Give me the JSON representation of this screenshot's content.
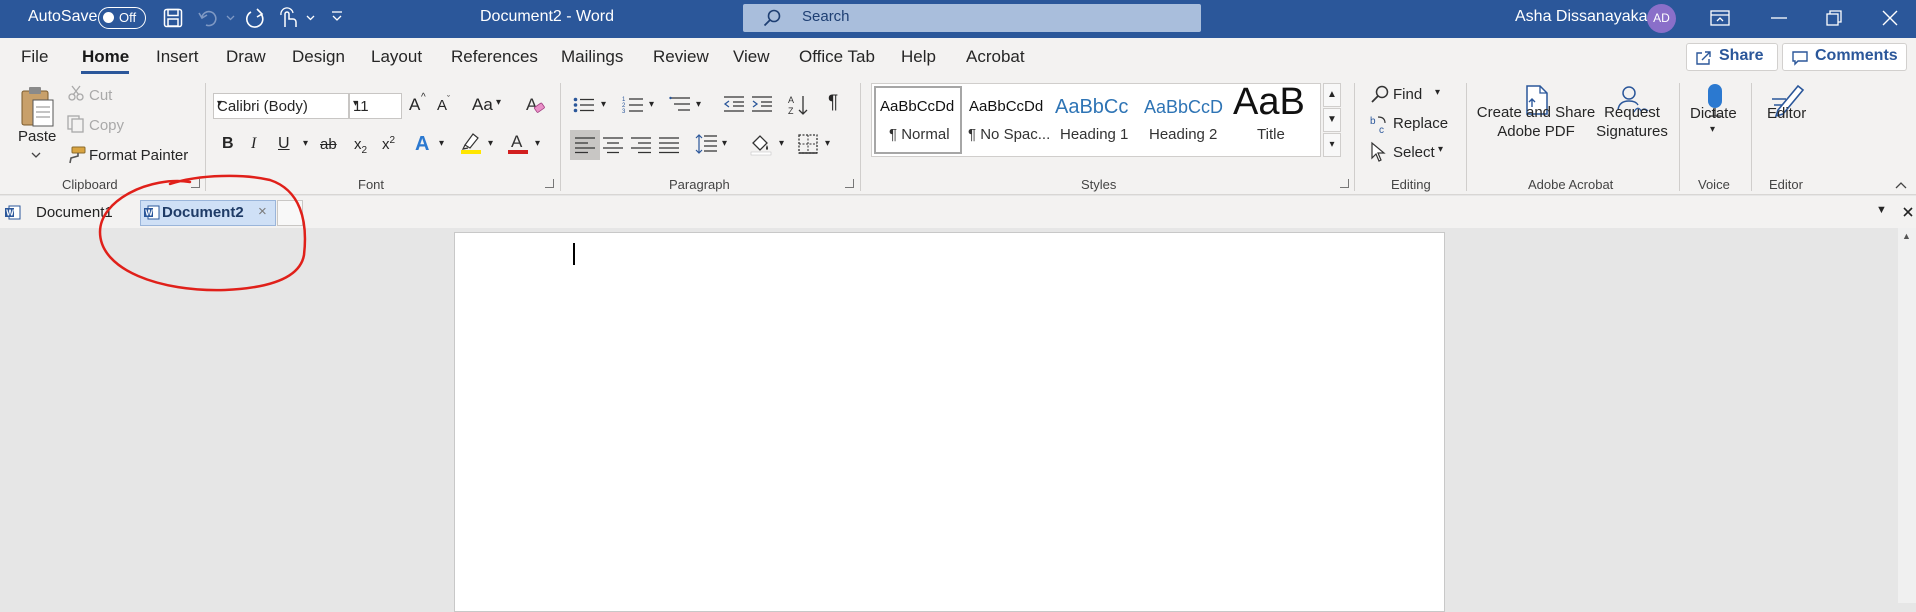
{
  "titlebar": {
    "autosave_label": "AutoSave",
    "autosave_state": "Off",
    "doc_title": "Document2  -  Word",
    "search_placeholder": "Search",
    "user_name": "Asha Dissanayaka",
    "user_initials": "AD"
  },
  "menu": {
    "items": [
      "File",
      "Home",
      "Insert",
      "Draw",
      "Design",
      "Layout",
      "References",
      "Mailings",
      "Review",
      "View",
      "Office Tab",
      "Help",
      "Acrobat"
    ],
    "active": "Home",
    "share_label": "Share",
    "comments_label": "Comments"
  },
  "clipboard": {
    "paste_label": "Paste",
    "cut_label": "Cut",
    "copy_label": "Copy",
    "format_painter_label": "Format Painter",
    "group_label": "Clipboard"
  },
  "font": {
    "font_name": "Calibri (Body)",
    "font_size": "11",
    "group_label": "Font",
    "bold": "B",
    "italic": "I",
    "underline": "U",
    "strike": "ab",
    "subscript": "x",
    "superscript": "x",
    "grow": "A",
    "shrink": "A",
    "change_case": "Aa",
    "effects": "A",
    "font_color": "A"
  },
  "paragraph": {
    "group_label": "Paragraph",
    "show_marks": "¶"
  },
  "styles": {
    "group_label": "Styles",
    "items": [
      {
        "preview": "AaBbCcDd",
        "name": "¶ Normal"
      },
      {
        "preview": "AaBbCcDd",
        "name": "¶ No Spac..."
      },
      {
        "preview": "AaBbCc",
        "name": "Heading 1"
      },
      {
        "preview": "AaBbCcD",
        "name": "Heading 2"
      },
      {
        "preview": "AaB",
        "name": "Title"
      }
    ]
  },
  "editing": {
    "group_label": "Editing",
    "find_label": "Find",
    "replace_label": "Replace",
    "select_label": "Select"
  },
  "acrobat": {
    "group_label": "Adobe Acrobat",
    "create_label_1": "Create and Share",
    "create_label_2": "Adobe PDF",
    "request_label_1": "Request",
    "request_label_2": "Signatures"
  },
  "voice": {
    "group_label": "Voice",
    "dictate_label": "Dictate"
  },
  "editor": {
    "group_label": "Editor",
    "editor_label": "Editor"
  },
  "doc_tabs": {
    "tab1": "Document1",
    "tab2": "Document2",
    "close": "×"
  },
  "colors": {
    "title_bar": "#2b579a",
    "annotation": "#e0201a",
    "highlight_yellow": "#ffe600",
    "font_red": "#d21f1f"
  }
}
